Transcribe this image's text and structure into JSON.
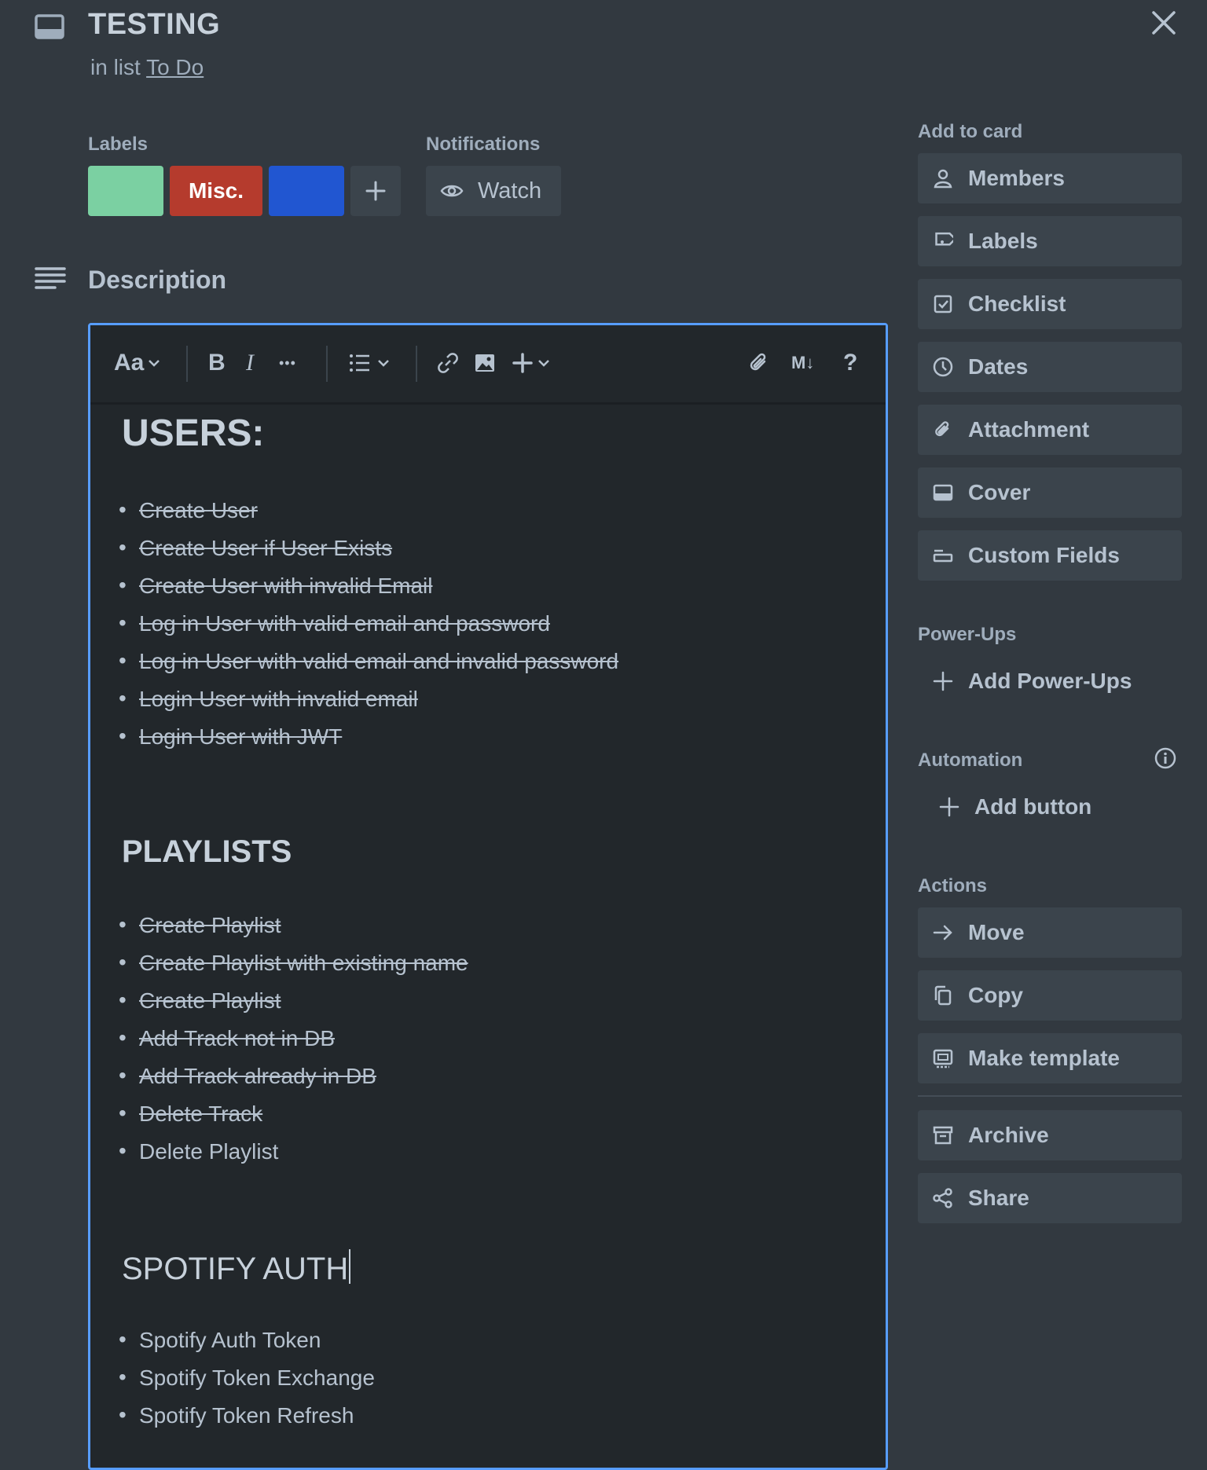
{
  "card": {
    "title": "TESTING",
    "in_list_prefix": "in list",
    "list_name": "To Do"
  },
  "labels": {
    "heading": "Labels",
    "items": [
      {
        "color": "#7bd0a2",
        "text": ""
      },
      {
        "color": "#b53b2d",
        "text": "Misc."
      },
      {
        "color": "#2156d1",
        "text": ""
      }
    ]
  },
  "notifications": {
    "heading": "Notifications",
    "watch_label": "Watch"
  },
  "description": {
    "heading": "Description",
    "toolbar": {
      "text_style": "Aa",
      "bold": "B",
      "italic": "I",
      "more": "•••",
      "markdown": "M↓",
      "help": "?"
    },
    "sections": [
      {
        "heading": "USERS:",
        "items": [
          {
            "text": "Create User",
            "done": true
          },
          {
            "text": "Create User if User Exists",
            "done": true
          },
          {
            "text": "Create User with invalid Email",
            "done": true
          },
          {
            "text": "Log in User with valid email and password",
            "done": true
          },
          {
            "text": "Log in User with valid email and invalid password",
            "done": true
          },
          {
            "text": "Login User with invalid email",
            "done": true
          },
          {
            "text": "Login User with JWT",
            "done": true
          }
        ]
      },
      {
        "heading": "PLAYLISTS",
        "items": [
          {
            "text": "Create Playlist",
            "done": true
          },
          {
            "text": "Create Playlist with existing name",
            "done": true
          },
          {
            "text": "Create Playlist ",
            "done": true
          },
          {
            "text": "Add Track not in DB",
            "done": true
          },
          {
            "text": "Add Track already in DB",
            "done": true
          },
          {
            "text": "Delete Track",
            "done": true
          },
          {
            "text": "Delete Playlist",
            "done": false
          }
        ]
      },
      {
        "heading": "SPOTIFY AUTH",
        "items": [
          {
            "text": "Spotify Auth Token",
            "done": false
          },
          {
            "text": "Spotify Token Exchange",
            "done": false
          },
          {
            "text": "Spotify Token Refresh",
            "done": false
          }
        ]
      }
    ]
  },
  "sidebar": {
    "add_to_card": {
      "heading": "Add to card",
      "items": [
        "Members",
        "Labels",
        "Checklist",
        "Dates",
        "Attachment",
        "Cover",
        "Custom Fields"
      ]
    },
    "power_ups": {
      "heading": "Power-Ups",
      "add_label": "Add Power-Ups"
    },
    "automation": {
      "heading": "Automation",
      "add_label": "Add button"
    },
    "actions": {
      "heading": "Actions",
      "items": [
        "Move",
        "Copy",
        "Make template",
        "Archive",
        "Share"
      ]
    }
  }
}
